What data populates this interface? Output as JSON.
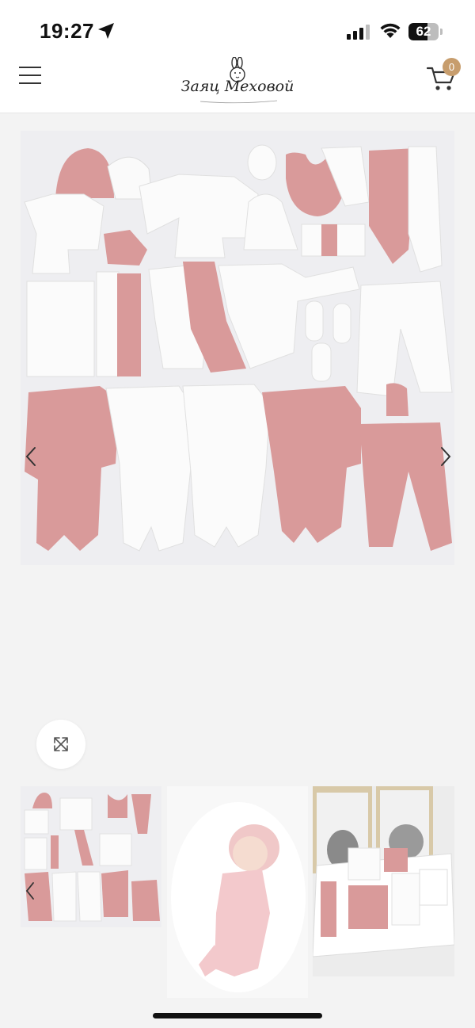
{
  "status_bar": {
    "time": "19:27",
    "battery": "62",
    "battery_level": 0.62
  },
  "header": {
    "logo_text": "Заяц Меховой",
    "cart_count": "0",
    "accent_color": "#c79d6d"
  },
  "gallery": {
    "main_image": "baby-clothes-set-flatlay",
    "prev_icon": "chevron-left-icon",
    "next_icon": "chevron-right-icon",
    "zoom_icon": "expand-icon"
  },
  "thumbnails": [
    {
      "image": "baby-clothes-set-flatlay"
    },
    {
      "image": "baby-in-pink-outfit"
    },
    {
      "image": "gift-box-with-bunny-prints"
    }
  ],
  "colors": {
    "pink": "#d99a9a",
    "white_fabric": "#fbfbfb",
    "background": "#f3f3f3"
  }
}
